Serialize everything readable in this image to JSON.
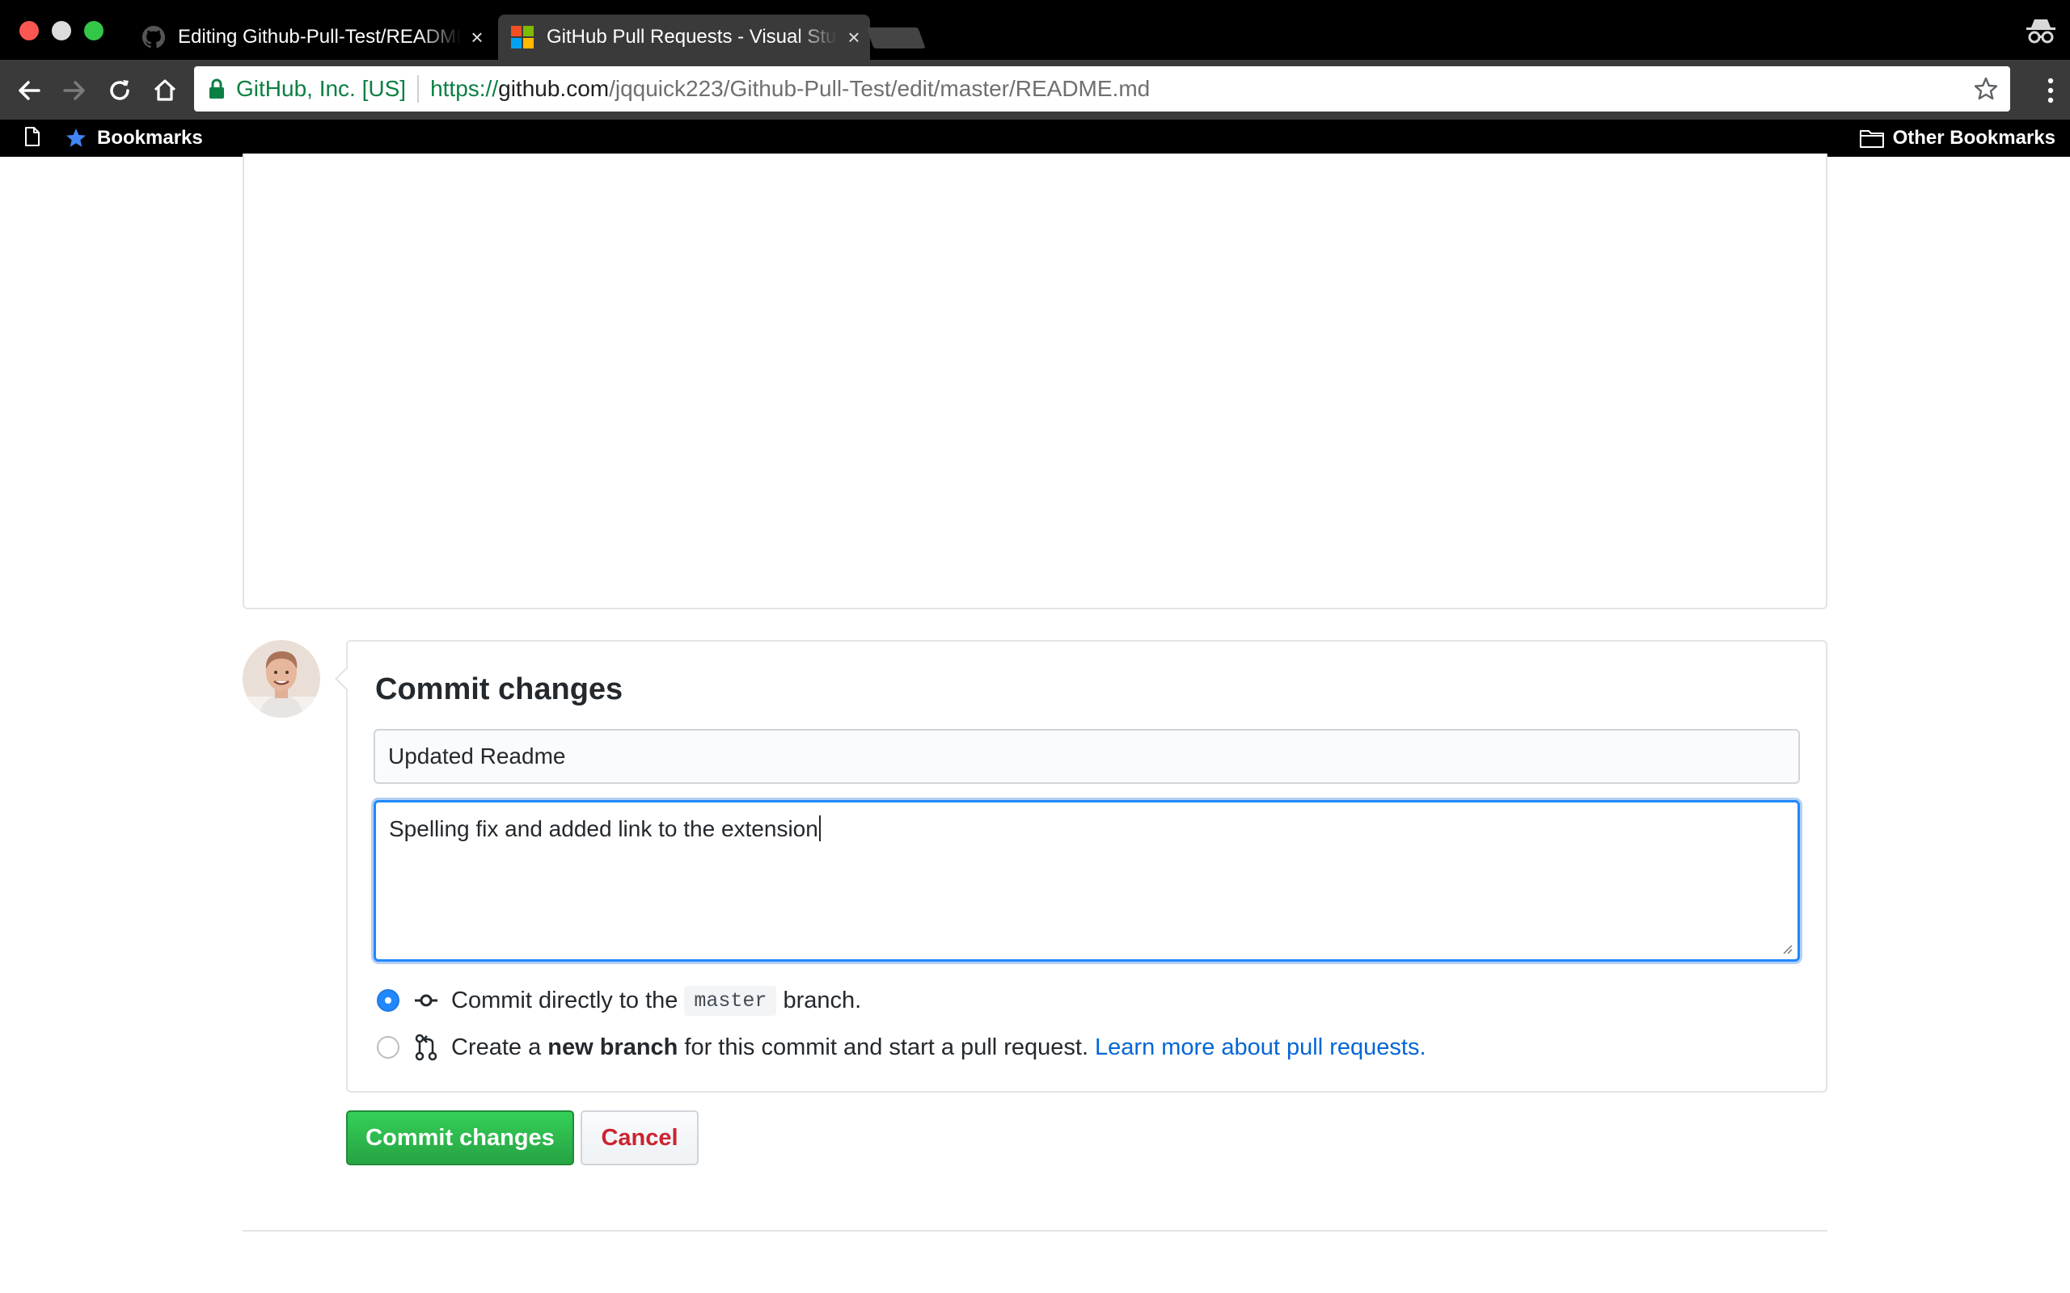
{
  "browser": {
    "tabs": [
      {
        "title": "Editing Github-Pull-Test/README.md",
        "favicon": "github-octocat-icon",
        "active": false,
        "close": "×"
      },
      {
        "title": "GitHub Pull Requests - Visual Studio Marketplace",
        "favicon": "microsoft-logo-icon",
        "active": true,
        "close": "×"
      }
    ],
    "address_bar": {
      "security_label": "GitHub, Inc. [US]",
      "url_scheme": "https://",
      "url_host": "github.com",
      "url_path": "/jqquick223/Github-Pull-Test/edit/master/README.md"
    },
    "bookmarks_bar": {
      "bookmarks_label": "Bookmarks",
      "other_label": "Other Bookmarks"
    }
  },
  "commit": {
    "title": "Commit changes",
    "summary_value": "Updated Readme",
    "description_value": "Spelling fix and added link to the extension",
    "option_direct": {
      "prefix": "Commit directly to the",
      "branch": "master",
      "suffix": "branch.",
      "selected": true
    },
    "option_new_branch": {
      "prefix": "Create a",
      "bold": "new branch",
      "suffix": "for this commit and start a pull request.",
      "link": "Learn more about pull requests.",
      "selected": false
    },
    "commit_button": "Commit changes",
    "cancel_button": "Cancel"
  },
  "colors": {
    "primary_button": "#28a745",
    "cancel_text": "#cb2431",
    "link": "#0366d6",
    "focus_ring": "#2188ff",
    "ev_green": "#0b8043"
  }
}
